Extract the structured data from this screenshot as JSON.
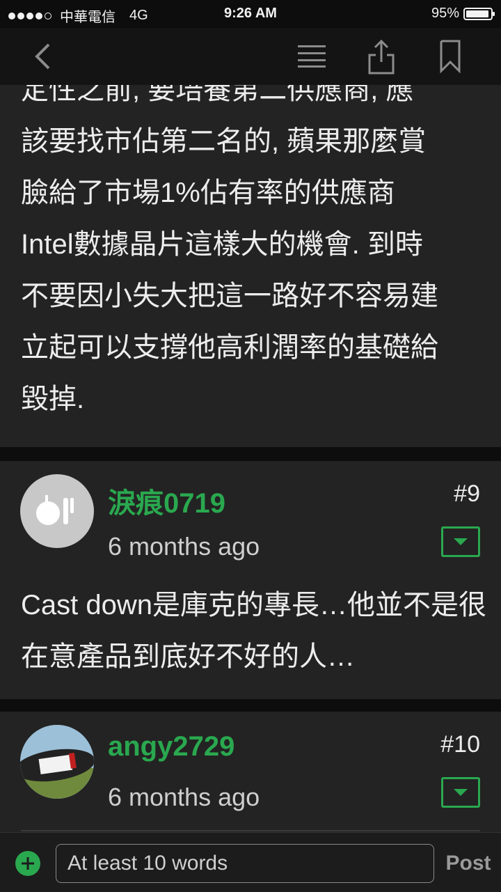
{
  "status_bar": {
    "carrier": "中華電信",
    "network": "4G",
    "time": "9:26 AM",
    "battery": "95%",
    "battery_level": 0.95,
    "signal_bars": 4
  },
  "nav": {
    "icons": [
      "back-icon",
      "menu-list-icon",
      "share-icon",
      "bookmark-icon"
    ]
  },
  "post": {
    "text": "定性之前, 要培養第二供應商, 應\n該要找市佔第二名的, 蘋果那麼賞\n臉給了市場1%佔有率的供應商\nIntel數據晶片這樣大的機會. 到時\n不要因小失大把這一路好不容易建\n立起可以支撐他高利潤率的基礎給\n毀掉."
  },
  "comments": [
    {
      "username": "淚痕0719",
      "time": "6 months ago",
      "floor": "#9",
      "body": "Cast down是庫克的專長…他並不是很在意產品到底好不好的人…"
    },
    {
      "username": "angy2729",
      "time": "6 months ago",
      "floor": "#10"
    }
  ],
  "composer": {
    "placeholder": "At least 10 words",
    "post_label": "Post"
  },
  "colors": {
    "accent": "#2aa84f",
    "card": "#232323",
    "background": "#0d0d0d"
  }
}
